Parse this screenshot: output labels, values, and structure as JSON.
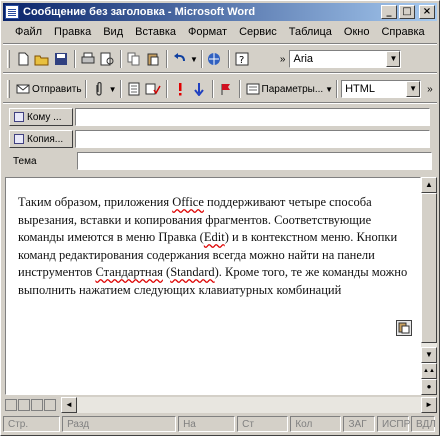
{
  "window": {
    "title": "Сообщение без заголовка - Microsoft Word"
  },
  "title_buttons": {
    "minimize": "_",
    "maximize": "□",
    "close": "×"
  },
  "menu": [
    "Файл",
    "Правка",
    "Вид",
    "Вставка",
    "Формат",
    "Сервис",
    "Таблица",
    "Окно",
    "Справка"
  ],
  "toolbar1": {
    "font_name": "Aria",
    "overflow": "»"
  },
  "toolbar2": {
    "send_label": "Отправить",
    "options_label": "Параметры...",
    "format_value": "HTML",
    "overflow": "»"
  },
  "fields": {
    "to_label": "Кому ...",
    "cc_label": "Копия...",
    "subject_label": "Тема"
  },
  "document": {
    "text_parts": [
      "Таким образом, приложения ",
      "Office",
      " поддерживают четыре способа вырезания, вставки и копирования фрагментов. Соответствующие команды имеются в меню Правка (",
      "Edit",
      ") и в контекстном меню. Кнопки команд редактирования содержания всегда можно найти на панели инструментов ",
      "Стандартная",
      " (",
      "Standard",
      "). Кроме того, те же команды можно выполнить нажатием следующих клавиатурных комбинаций"
    ]
  },
  "status": {
    "page": "Стр.",
    "section": "Разд",
    "at": "На",
    "line": "Ст",
    "col": "Кол",
    "rec": "ЗАГ",
    "trk": "ИСПР",
    "ext": "ВДЛ"
  },
  "colors": {
    "title_start": "#0a246a",
    "title_end": "#a6caf0",
    "spell_underline": "#d00"
  }
}
